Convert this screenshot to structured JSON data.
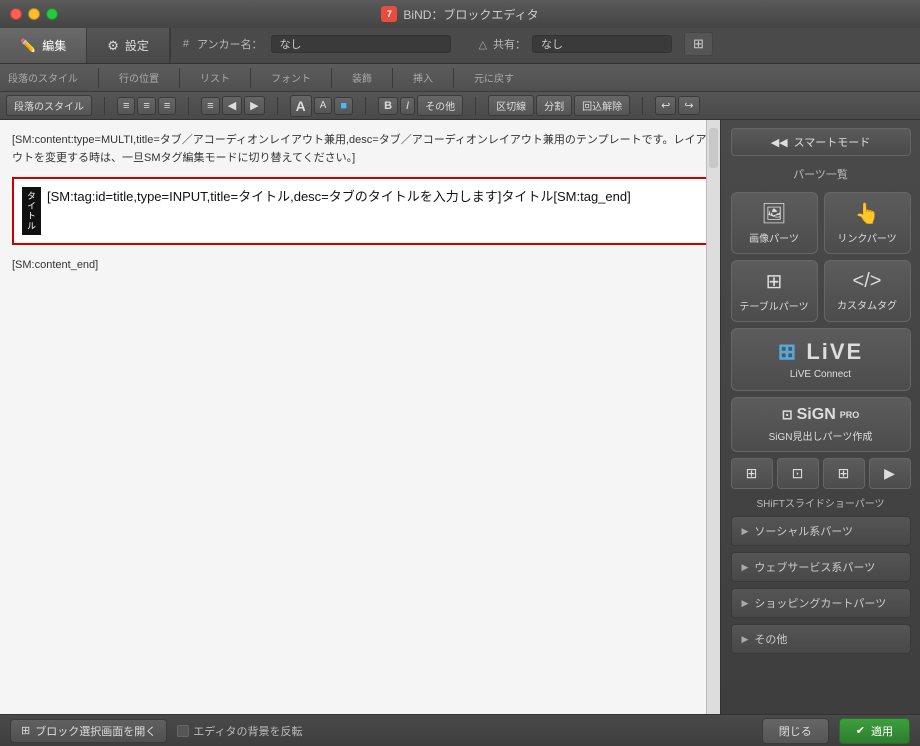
{
  "titlebar": {
    "title": "BiND：ブロックエディタ",
    "icon_label": "7"
  },
  "tabs": {
    "edit_label": "編集",
    "settings_label": "設定"
  },
  "anchor": {
    "hash_symbol": "#",
    "label": "アンカー名：",
    "value": "なし"
  },
  "share": {
    "icon": "△",
    "label": "共有：",
    "value": "なし"
  },
  "toolbar1": {
    "paragraph_style": "段落のスタイル",
    "line_position": "行の位置",
    "list": "リスト",
    "font": "フォント",
    "decoration": "装飾",
    "insert": "挿入",
    "revert": "元に戻す"
  },
  "toolbar2": {
    "paragraph_style_btn": "段落のスタイル",
    "align_left": "≡",
    "align_center": "≡",
    "align_right": "≡",
    "list_btn": "≡",
    "back": "◀",
    "forward": "▶",
    "font_A": "A",
    "font_a": "A",
    "color_box": "■",
    "bold": "B",
    "italic": "I",
    "other": "その他",
    "insert_split": "区切線",
    "insert_divide": "分割",
    "insert_wrap": "回込解除",
    "undo": "↩",
    "redo": "↪"
  },
  "editor": {
    "sm_content_text": "[SM:content:type=MULTI,title=タブ／アコーディオンレイアウト兼用,desc=タブ／アコーディオンレイアウト兼用のテンプレートです。レイアウトを変更する時は、一旦SMタグ編集モードに切り替えてください。]",
    "tag_vertical_label": "タイトル",
    "tag_content": "[SM:tag:id=title,type=INPUT,title=タイトル,desc=タブのタイトルを入力します]タイトル[SM:tag_end]",
    "sm_end_text": "[SM:content_end]"
  },
  "right_panel": {
    "smart_mode_label": "スマートモード",
    "smart_mode_arrow": "◀◀",
    "parts_label": "パーツ一覧",
    "image_parts": "画像パーツ",
    "link_parts": "リンクパーツ",
    "table_parts": "テーブルパーツ",
    "custom_tag": "カスタムタグ",
    "live_connect": "LiVE Connect",
    "live_icon": "LiVE",
    "sign_pro_label": "SiGN見出しパーツ作成",
    "sign_icon": "SiGN PRO",
    "shift_label": "SHiFTスライドショーパーツ",
    "social_label": "ソーシャル系パーツ",
    "web_label": "ウェブサービス系パーツ",
    "shopping_label": "ショッピングカートパーツ",
    "other_label": "その他"
  },
  "bottom": {
    "open_block_label": "ブロック選択画面を開く",
    "grid_icon": "⊞",
    "bg_toggle_label": "エディタの背景を反転",
    "close_label": "閉じる",
    "apply_label": "適用",
    "apply_icon": "✔"
  }
}
